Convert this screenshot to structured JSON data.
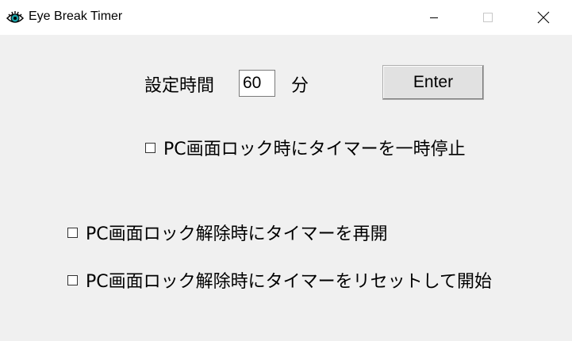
{
  "window": {
    "title": "Eye Break Timer",
    "icon": "eye-icon",
    "controls": [
      "minimize-icon",
      "maximize-icon",
      "close-icon"
    ]
  },
  "settings": {
    "label": "設定時間",
    "minutes_value": "60",
    "unit": "分",
    "enter_label": "Enter"
  },
  "options": {
    "pause_on_lock": {
      "label": "PC画面ロック時にタイマーを一時停止",
      "checked": false
    },
    "resume_on_unlock": {
      "label": "PC画面ロック解除時にタイマーを再開",
      "checked": false
    },
    "reset_on_unlock": {
      "label": "PC画面ロック解除時にタイマーをリセットして開始",
      "checked": false
    }
  },
  "colors": {
    "client_bg": "#f0f0f0",
    "titlebar_bg": "#ffffff",
    "icon_teal": "#1aa3a8"
  }
}
